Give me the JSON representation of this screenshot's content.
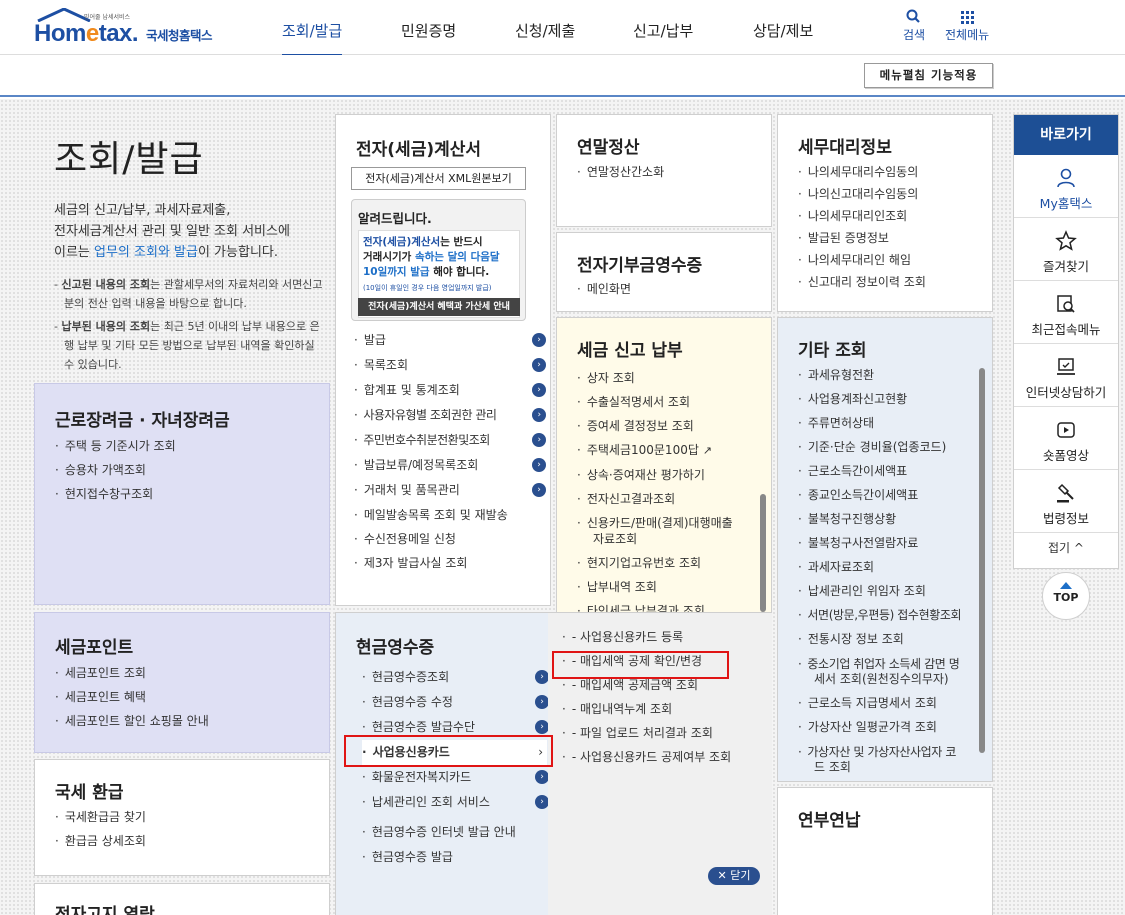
{
  "header": {
    "logo_brand_a": "Hom",
    "logo_brand_e": "e",
    "logo_brand_b": "tax.",
    "logo_sub": "국세청홈택스",
    "logo_tiny": "믿어줄 납세서비스",
    "nav": [
      "조회/발급",
      "민원증명",
      "신청/제출",
      "신고/납부",
      "상담/제보"
    ],
    "search_label": "검색",
    "all_menu_label": "전체메뉴"
  },
  "toolbar": {
    "menu_expand_button": "메뉴펼침 기능적용"
  },
  "intro": {
    "title": "조회/발급",
    "desc_1": "세금의 신고/납부, 과세자료제출,",
    "desc_2": "전자세금계산서 관리 및 일반 조회 서비스에",
    "desc_3a": "이르는 ",
    "desc_3b": "업무의 조회와 발급",
    "desc_3c": "이 가능합니다.",
    "note_1_bold": "신고된 내용의 조회",
    "note_1_rest": "는 관할세무서의 자료처리와 서면신고분의 전산 입력 내용을 바탕으로 합니다.",
    "note_2_bold": "납부된 내용의 조회",
    "note_2_rest": "는 최근 5년 이내의 납부 내용으로 은행 납부 및 기타 모든 방법으로 납부된 내역을 확인하실 수 있습니다."
  },
  "cards": {
    "einvoice": {
      "title": "전자(세금)계산서",
      "xml_button": "전자(세금)계산서 XML원본보기",
      "notice_title": "알려드립니다.",
      "notice_b1": "전자(세금)계산서",
      "notice_t1": "는 반드시",
      "notice_t2": "거래시기가 ",
      "notice_b2": "속하는 달의 다음달",
      "notice_b3": "10일까지 발급",
      "notice_t3": " 해야 합니다.",
      "notice_small": "(10일이 휴일인 경우 다음 영업일까지 발급)",
      "notice_button": "전자(세금)계산서 혜택과 가산세 안내",
      "items": [
        "발급",
        "목록조회",
        "합계표 및 통계조회",
        "사용자유형별 조회권한 관리",
        "주민번호수취분전환및조회",
        "발급보류/예정목록조회",
        "거래처 및 품목관리",
        "메일발송목록 조회 및 재발송",
        "수신전용메일 신청",
        "제3자 발급사실 조회"
      ]
    },
    "yearend": {
      "title": "연말정산",
      "items": [
        "연말정산간소화"
      ]
    },
    "taxagent": {
      "title": "세무대리정보",
      "items": [
        "나의세무대리수임동의",
        "나의신고대리수임동의",
        "나의세무대리인조회",
        "발급된 증명정보",
        "나의세무대리인 해임",
        "신고대리 정보이력 조회"
      ]
    },
    "donation": {
      "title": "전자기부금영수증",
      "items": [
        "메인화면"
      ]
    },
    "taxreport": {
      "title": "세금 신고 납부",
      "items": [
        "상자 조회",
        "수출실적명세서 조회",
        "증여세 결정정보 조회",
        "주택세금100문100답",
        "상속·증여재산 평가하기",
        "전자신고결과조회",
        "신용카드/판매(결제)대행매출",
        "자료조회",
        "현지기업고유번호 조회",
        "납부내역 조회",
        "타인세금 납부결과 조회"
      ]
    },
    "other": {
      "title": "기타 조회",
      "items": [
        "과세유형전환",
        "사업용계좌신고현황",
        "주류면허상태",
        "기준·단순 경비율(업종코드)",
        "근로소득간이세액표",
        "종교인소득간이세액표",
        "불복청구진행상황",
        "불복청구사전열람자료",
        "과세자료조회",
        "납세관리인 위임자 조회",
        "서면(방문,우편등) 접수현황조회",
        "전통시장 정보 조회",
        "중소기업 취업자 소득세 감면 명",
        "세서 조회(원천징수의무자)",
        "근로소득 지급명세서 조회",
        "가상자산 일평균가격 조회",
        "가상자산 및 가상자산사업자 코",
        "드 조회"
      ]
    },
    "earned": {
      "title": "근로장려금 · 자녀장려금",
      "items": [
        "주택 등 기준시가 조회",
        "승용차 가액조회",
        "현지접수창구조회"
      ]
    },
    "points": {
      "title": "세금포인트",
      "items": [
        "세금포인트 조회",
        "세금포인트 혜택",
        "세금포인트 할인 쇼핑몰 안내"
      ]
    },
    "refund": {
      "title": "국세 환급",
      "items": [
        "국세환급금 찾기",
        "환급금 상세조회"
      ]
    },
    "enotice": {
      "title": "전자고지 열람"
    },
    "cashreceipt": {
      "title": "현금영수증",
      "items": [
        "현금영수증조회",
        "현금영수증 수정",
        "현금영수증 발급수단",
        "사업용신용카드",
        "화물운전자복지카드",
        "납세관리인 조회 서비스",
        "현금영수증 인터넷 발급 안내",
        "현금영수증 발급"
      ],
      "sub_items": [
        "사업용신용카드 등록",
        "매입세액 공제 확인/변경",
        "매입세액 공제금액 조회",
        "매입내역누계 조회",
        "파일 업로드 처리결과 조회",
        "사업용신용카드 공제여부 조회"
      ],
      "close_label": "닫기"
    },
    "yearly": {
      "title": "연부연납"
    }
  },
  "sidebar": {
    "title": "바로가기",
    "items": [
      "My홈택스",
      "즐겨찾기",
      "최근접속메뉴",
      "인터넷상담하기",
      "숏폼영상",
      "법령정보"
    ],
    "fold_label": "접기",
    "top_label": "TOP"
  }
}
